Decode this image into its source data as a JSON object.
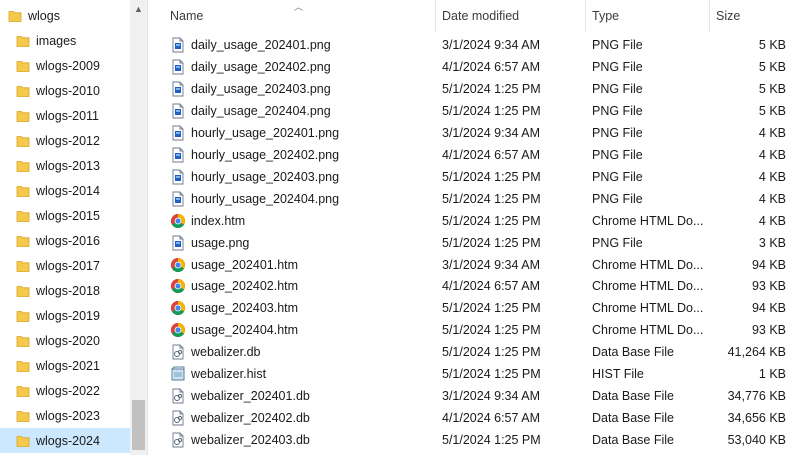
{
  "nav": {
    "root": {
      "label": "wlogs"
    },
    "items": [
      {
        "label": "images"
      },
      {
        "label": "wlogs-2009"
      },
      {
        "label": "wlogs-2010"
      },
      {
        "label": "wlogs-2011"
      },
      {
        "label": "wlogs-2012"
      },
      {
        "label": "wlogs-2013"
      },
      {
        "label": "wlogs-2014"
      },
      {
        "label": "wlogs-2015"
      },
      {
        "label": "wlogs-2016"
      },
      {
        "label": "wlogs-2017"
      },
      {
        "label": "wlogs-2018"
      },
      {
        "label": "wlogs-2019"
      },
      {
        "label": "wlogs-2020"
      },
      {
        "label": "wlogs-2021"
      },
      {
        "label": "wlogs-2022"
      },
      {
        "label": "wlogs-2023"
      },
      {
        "label": "wlogs-2024",
        "selected": true
      }
    ]
  },
  "columns": {
    "name": "Name",
    "date": "Date modified",
    "type": "Type",
    "size": "Size"
  },
  "files": [
    {
      "name": "daily_usage_202401.png",
      "date": "3/1/2024 9:34 AM",
      "type": "PNG File",
      "size": "5 KB",
      "icon": "png-file-icon"
    },
    {
      "name": "daily_usage_202402.png",
      "date": "4/1/2024 6:57 AM",
      "type": "PNG File",
      "size": "5 KB",
      "icon": "png-file-icon"
    },
    {
      "name": "daily_usage_202403.png",
      "date": "5/1/2024 1:25 PM",
      "type": "PNG File",
      "size": "5 KB",
      "icon": "png-file-icon"
    },
    {
      "name": "daily_usage_202404.png",
      "date": "5/1/2024 1:25 PM",
      "type": "PNG File",
      "size": "5 KB",
      "icon": "png-file-icon"
    },
    {
      "name": "hourly_usage_202401.png",
      "date": "3/1/2024 9:34 AM",
      "type": "PNG File",
      "size": "4 KB",
      "icon": "png-file-icon"
    },
    {
      "name": "hourly_usage_202402.png",
      "date": "4/1/2024 6:57 AM",
      "type": "PNG File",
      "size": "4 KB",
      "icon": "png-file-icon"
    },
    {
      "name": "hourly_usage_202403.png",
      "date": "5/1/2024 1:25 PM",
      "type": "PNG File",
      "size": "4 KB",
      "icon": "png-file-icon"
    },
    {
      "name": "hourly_usage_202404.png",
      "date": "5/1/2024 1:25 PM",
      "type": "PNG File",
      "size": "4 KB",
      "icon": "png-file-icon"
    },
    {
      "name": "index.htm",
      "date": "5/1/2024 1:25 PM",
      "type": "Chrome HTML Do...",
      "size": "4 KB",
      "icon": "chrome-icon"
    },
    {
      "name": "usage.png",
      "date": "5/1/2024 1:25 PM",
      "type": "PNG File",
      "size": "3 KB",
      "icon": "png-file-icon"
    },
    {
      "name": "usage_202401.htm",
      "date": "3/1/2024 9:34 AM",
      "type": "Chrome HTML Do...",
      "size": "94 KB",
      "icon": "chrome-icon"
    },
    {
      "name": "usage_202402.htm",
      "date": "4/1/2024 6:57 AM",
      "type": "Chrome HTML Do...",
      "size": "93 KB",
      "icon": "chrome-icon"
    },
    {
      "name": "usage_202403.htm",
      "date": "5/1/2024 1:25 PM",
      "type": "Chrome HTML Do...",
      "size": "94 KB",
      "icon": "chrome-icon"
    },
    {
      "name": "usage_202404.htm",
      "date": "5/1/2024 1:25 PM",
      "type": "Chrome HTML Do...",
      "size": "93 KB",
      "icon": "chrome-icon"
    },
    {
      "name": "webalizer.db",
      "date": "5/1/2024 1:25 PM",
      "type": "Data Base File",
      "size": "41,264 KB",
      "icon": "db-file-icon"
    },
    {
      "name": "webalizer.hist",
      "date": "5/1/2024 1:25 PM",
      "type": "HIST File",
      "size": "1 KB",
      "icon": "hist-file-icon"
    },
    {
      "name": "webalizer_202401.db",
      "date": "3/1/2024 9:34 AM",
      "type": "Data Base File",
      "size": "34,776 KB",
      "icon": "db-file-icon"
    },
    {
      "name": "webalizer_202402.db",
      "date": "4/1/2024 6:57 AM",
      "type": "Data Base File",
      "size": "34,656 KB",
      "icon": "db-file-icon"
    },
    {
      "name": "webalizer_202403.db",
      "date": "5/1/2024 1:25 PM",
      "type": "Data Base File",
      "size": "53,040 KB",
      "icon": "db-file-icon"
    }
  ],
  "colors": {
    "selection": "#cce8ff",
    "folder": "#f5c94c",
    "file_blue": "#1f5fbf"
  }
}
